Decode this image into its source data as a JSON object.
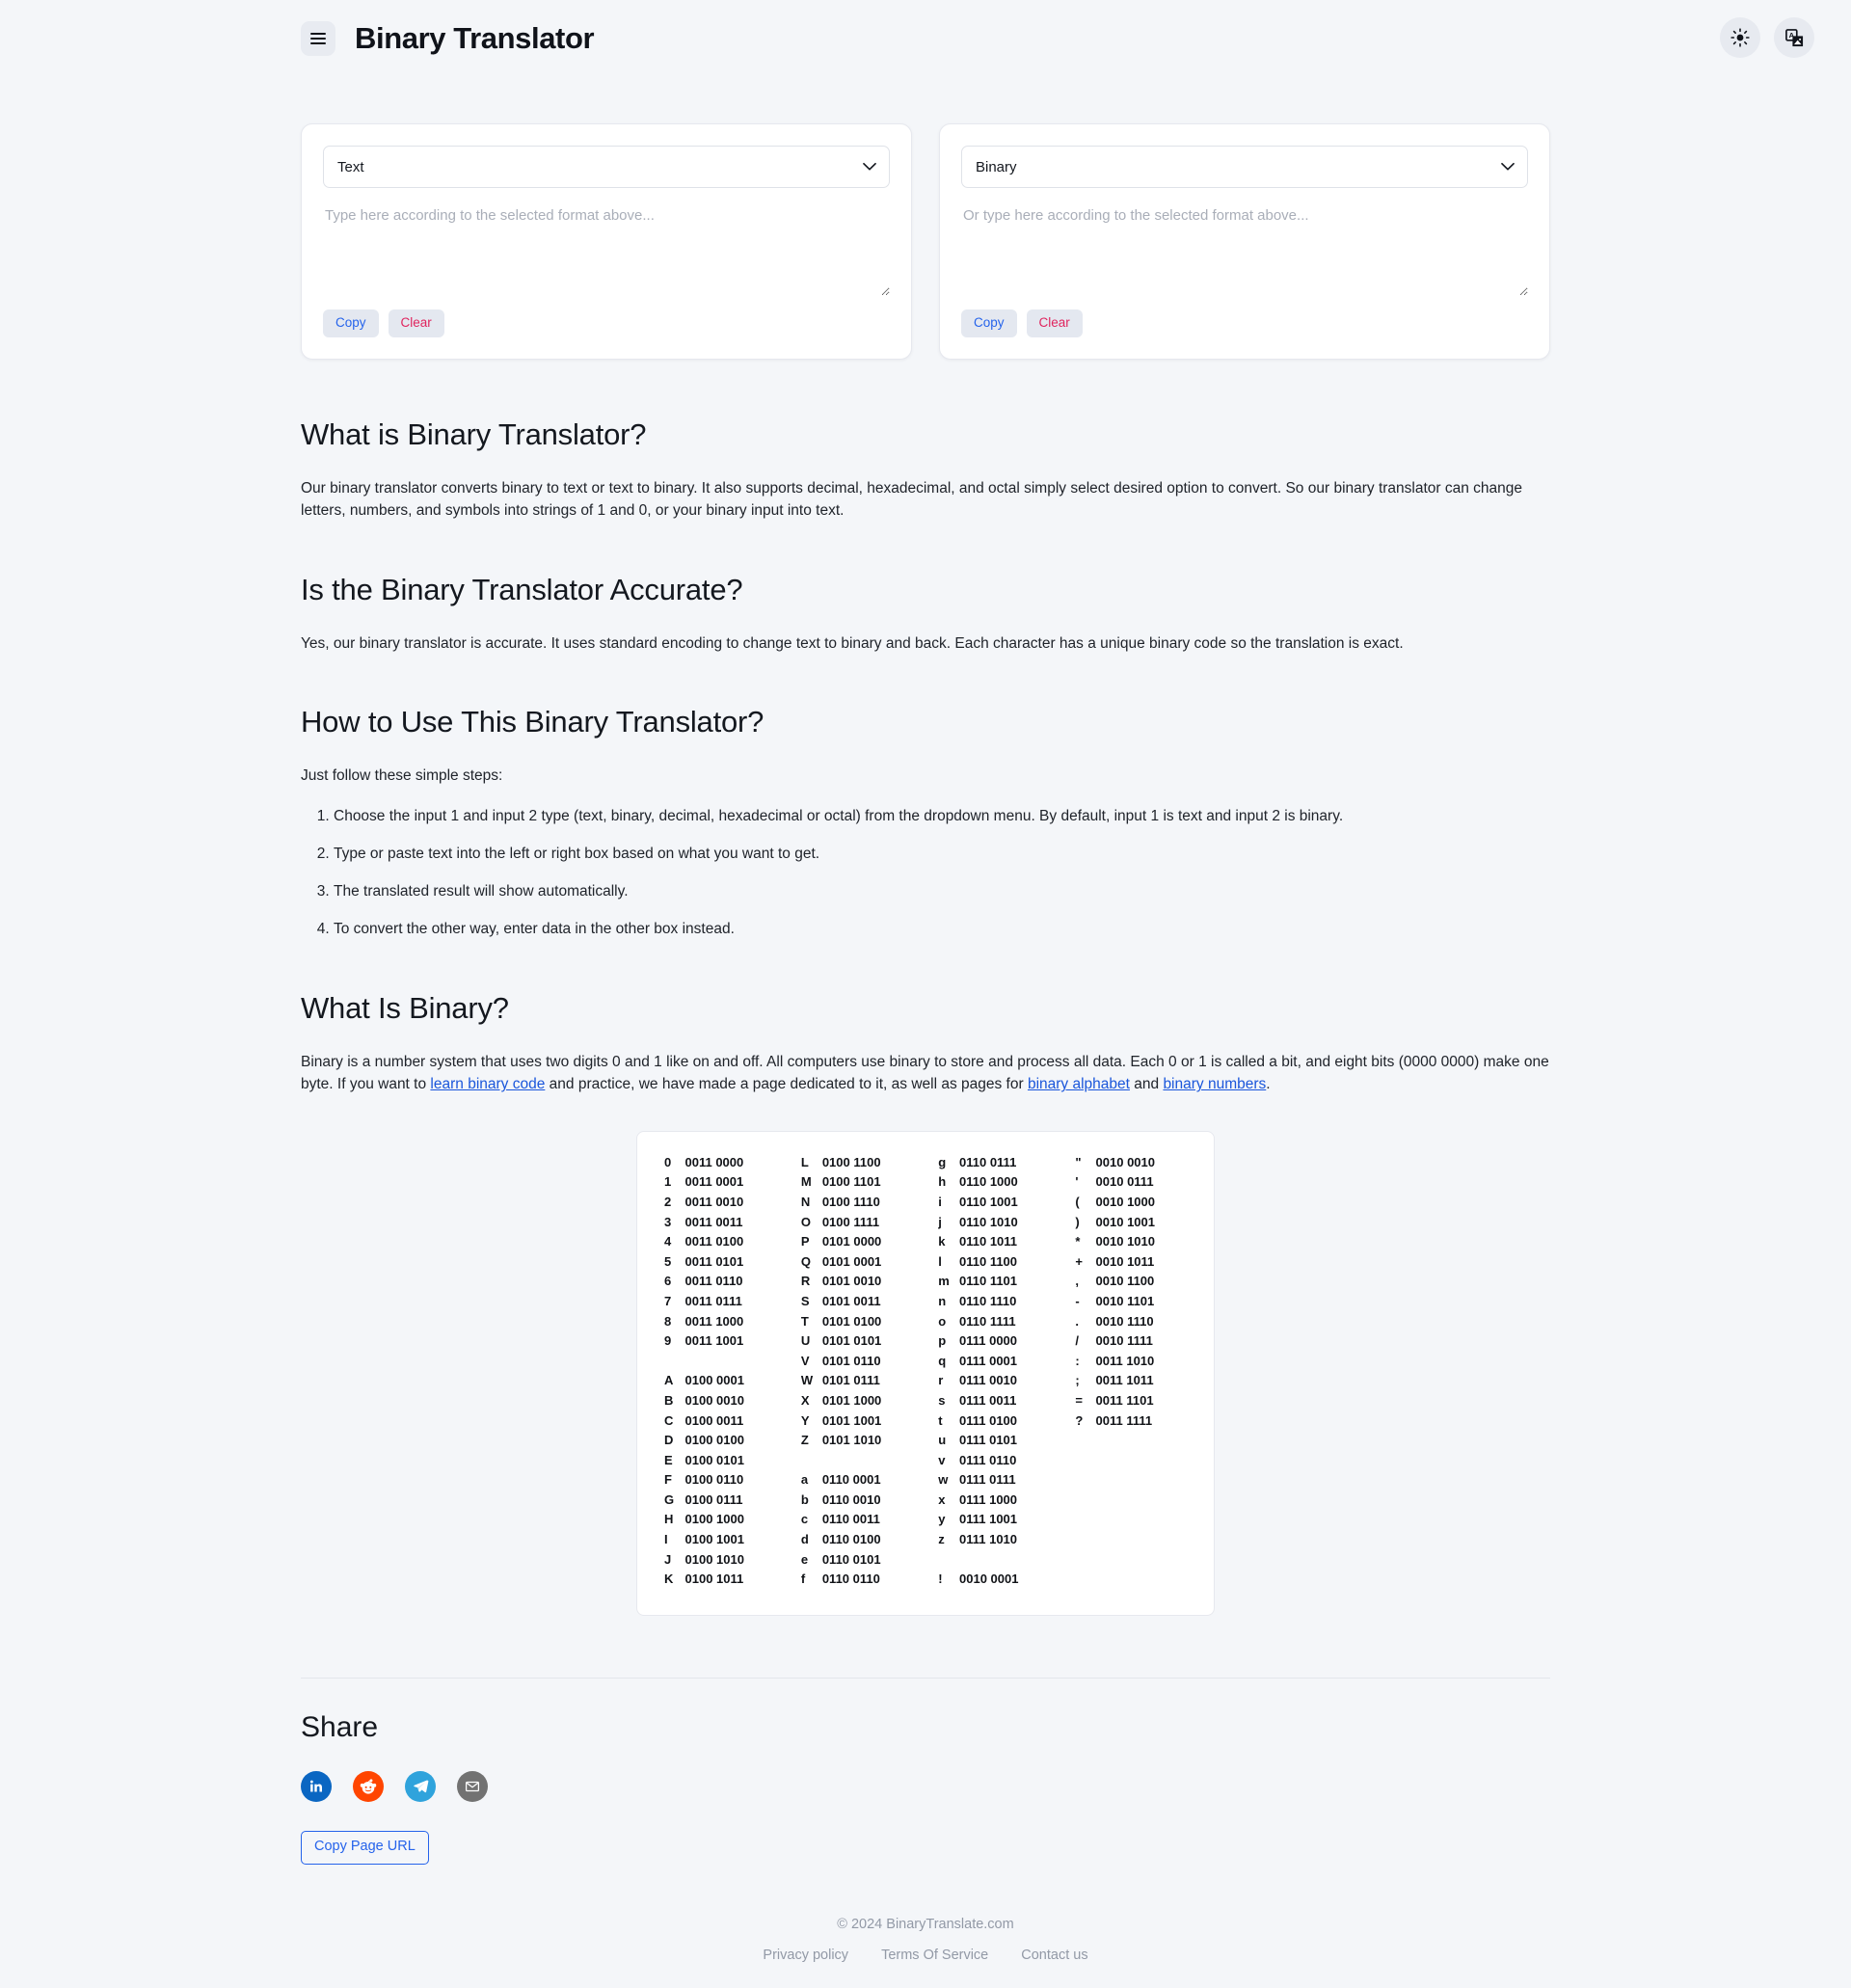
{
  "header": {
    "title": "Binary Translator",
    "menu_icon": "hamburger-icon",
    "theme_icon": "sun-icon",
    "language_icon": "translate-icon"
  },
  "converter": {
    "left": {
      "format_value": "Text",
      "format_options": [
        "Text",
        "Binary",
        "Decimal",
        "Hexadecimal",
        "Octal"
      ],
      "placeholder": "Type here according to the selected format above...",
      "value": "",
      "copy_label": "Copy",
      "clear_label": "Clear"
    },
    "right": {
      "format_value": "Binary",
      "format_options": [
        "Text",
        "Binary",
        "Decimal",
        "Hexadecimal",
        "Octal"
      ],
      "placeholder": "Or type here according to the selected format above...",
      "value": "",
      "copy_label": "Copy",
      "clear_label": "Clear"
    }
  },
  "article": {
    "h_what_is": "What is Binary Translator?",
    "p_what_is": "Our binary translator converts binary to text or text to binary. It also supports decimal, hexadecimal, and octal simply select desired option to convert. So our binary translator can change letters, numbers, and symbols into strings of 1 and 0, or your binary input into text.",
    "h_accurate": "Is the Binary Translator Accurate?",
    "p_accurate": "Yes, our binary translator is accurate. It uses standard encoding to change text to binary and back. Each character has a unique binary code so the translation is exact.",
    "h_how_to": "How to Use This Binary Translator?",
    "p_how_to_intro": "Just follow these simple steps:",
    "steps": [
      "Choose the input 1 and input 2 type (text, binary, decimal, hexadecimal or octal) from the dropdown menu. By default, input 1 is text and input 2 is binary.",
      "Type or paste text into the left or right box based on what you want to get.",
      "The translated result will show automatically.",
      "To convert the other way, enter data in the other box instead."
    ],
    "h_what_is_binary": "What Is Binary?",
    "p_binary_1": "Binary is a number system that uses two digits 0 and 1 like on and off. All computers use binary to store and process all data. Each 0 or 1 is called a bit, and eight bits (0000 0000) make one byte. If you want to ",
    "link_learn": "learn binary code",
    "p_binary_2": " and practice, we have made a page dedicated to it, as well as pages for ",
    "link_alphabet": "binary alphabet",
    "p_binary_3": " and ",
    "link_numbers": "binary numbers",
    "p_binary_4": "."
  },
  "binary_table": {
    "rows": [
      [
        "0",
        "0011 0000",
        "L",
        "0100 1100",
        "g",
        "0110 0111",
        "\"",
        "0010 0010"
      ],
      [
        "1",
        "0011 0001",
        "M",
        "0100 1101",
        "h",
        "0110 1000",
        "'",
        "0010 0111"
      ],
      [
        "2",
        "0011 0010",
        "N",
        "0100 1110",
        "i",
        "0110 1001",
        "(",
        "0010 1000"
      ],
      [
        "3",
        "0011 0011",
        "O",
        "0100 1111",
        "j",
        "0110 1010",
        ")",
        "0010 1001"
      ],
      [
        "4",
        "0011 0100",
        "P",
        "0101 0000",
        "k",
        "0110 1011",
        "*",
        "0010 1010"
      ],
      [
        "5",
        "0011 0101",
        "Q",
        "0101 0001",
        "l",
        "0110 1100",
        "+",
        "0010 1011"
      ],
      [
        "6",
        "0011 0110",
        "R",
        "0101 0010",
        "m",
        "0110 1101",
        ",",
        "0010 1100"
      ],
      [
        "7",
        "0011 0111",
        "S",
        "0101 0011",
        "n",
        "0110 1110",
        "-",
        "0010 1101"
      ],
      [
        "8",
        "0011 1000",
        "T",
        "0101 0100",
        "o",
        "0110 1111",
        ".",
        "0010 1110"
      ],
      [
        "9",
        "0011 1001",
        "U",
        "0101 0101",
        "p",
        "0111 0000",
        "/",
        "0010 1111"
      ],
      [
        "",
        "",
        "V",
        "0101 0110",
        "q",
        "0111 0001",
        ":",
        "0011 1010"
      ],
      [
        "A",
        "0100 0001",
        "W",
        "0101 0111",
        "r",
        "0111 0010",
        ";",
        "0011 1011"
      ],
      [
        "B",
        "0100 0010",
        "X",
        "0101 1000",
        "s",
        "0111 0011",
        "=",
        "0011 1101"
      ],
      [
        "C",
        "0100 0011",
        "Y",
        "0101 1001",
        "t",
        "0111 0100",
        "?",
        "0011 1111"
      ],
      [
        "D",
        "0100 0100",
        "Z",
        "0101 1010",
        "u",
        "0111 0101",
        "",
        ""
      ],
      [
        "E",
        "0100 0101",
        "",
        "",
        "v",
        "0111 0110",
        "",
        ""
      ],
      [
        "F",
        "0100 0110",
        "a",
        "0110 0001",
        "w",
        "0111 0111",
        "",
        ""
      ],
      [
        "G",
        "0100 0111",
        "b",
        "0110 0010",
        "x",
        "0111 1000",
        "",
        ""
      ],
      [
        "H",
        "0100 1000",
        "c",
        "0110 0011",
        "y",
        "0111 1001",
        "",
        ""
      ],
      [
        "I",
        "0100 1001",
        "d",
        "0110 0100",
        "z",
        "0111 1010",
        "",
        ""
      ],
      [
        "J",
        "0100 1010",
        "e",
        "0110 0101",
        "",
        "",
        "",
        ""
      ],
      [
        "K",
        "0100 1011",
        "f",
        "0110 0110",
        "!",
        "0010 0001",
        "",
        ""
      ]
    ]
  },
  "share": {
    "title": "Share",
    "networks": [
      {
        "name": "linkedin",
        "icon": "linkedin-icon",
        "color": "#0A66C2"
      },
      {
        "name": "reddit",
        "icon": "reddit-icon",
        "color": "#FF4500"
      },
      {
        "name": "telegram",
        "icon": "telegram-icon",
        "color": "#2FA3DC"
      },
      {
        "name": "email",
        "icon": "email-icon",
        "color": "#727272"
      }
    ],
    "copy_url_label": "Copy Page URL"
  },
  "footer": {
    "copyright": "© 2024 BinaryTranslate.com",
    "links": [
      "Privacy policy",
      "Terms Of Service",
      "Contact us"
    ]
  },
  "colors": {
    "page_bg": "#f4f6f9",
    "accent_blue": "#2563eb",
    "accent_red": "#e0245e",
    "link_blue": "#1a56db"
  }
}
